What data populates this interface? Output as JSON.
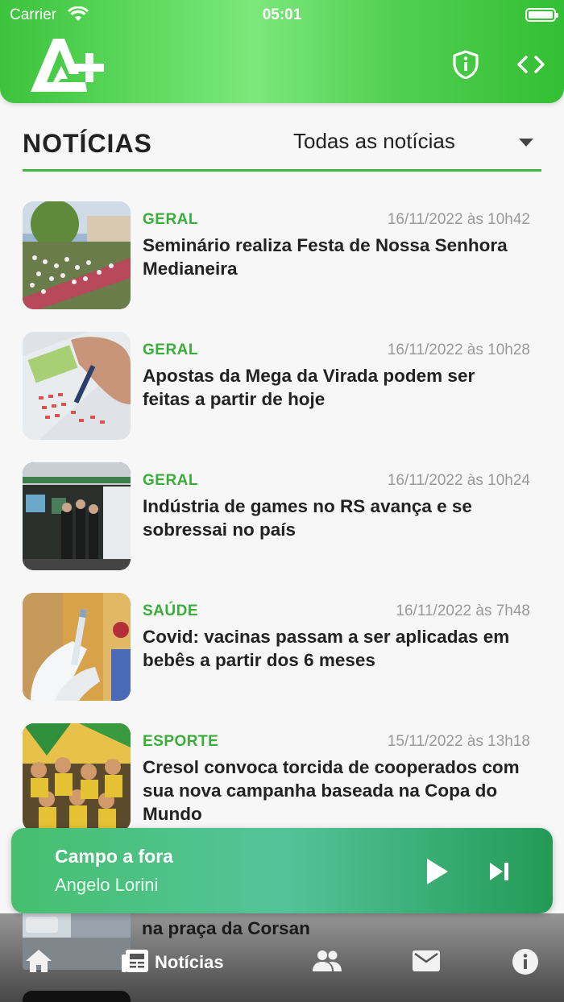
{
  "status_bar": {
    "carrier": "Carrier",
    "time": "05:01"
  },
  "header": {
    "logo_icon": "a-plus-logo-icon",
    "privacy_icon": "shield-info-icon",
    "embed_icon": "code-icon"
  },
  "section": {
    "title": "NOTÍCIAS",
    "filter_label": "Todas as notícias"
  },
  "news": [
    {
      "category": "GERAL",
      "date": "16/11/2022 às 10h42",
      "title": "Seminário realiza Festa de Nossa Senhora Medianeira"
    },
    {
      "category": "GERAL",
      "date": "16/11/2022 às 10h28",
      "title": "Apostas da Mega da Virada podem ser feitas a partir de hoje"
    },
    {
      "category": "GERAL",
      "date": "16/11/2022 às 10h24",
      "title": "Indústria de games no RS avança e se sobressai no país"
    },
    {
      "category": "SAÚDE",
      "date": "16/11/2022 às 7h48",
      "title": "Covid: vacinas passam a ser aplicadas em bebês a partir dos 6 meses"
    },
    {
      "category": "ESPORTE",
      "date": "15/11/2022 às 13h18",
      "title": "Cresol convoca torcida de cooperados com sua nova campanha baseada na Copa do Mundo"
    }
  ],
  "peek_item": {
    "title": "na praça da Corsan"
  },
  "player": {
    "title": "Campo a fora",
    "subtitle": "Angelo Lorini"
  },
  "tabs": {
    "news_label": "Notícias"
  },
  "colors": {
    "brand_green": "#3dba3d",
    "category_green": "#3aad3a"
  }
}
